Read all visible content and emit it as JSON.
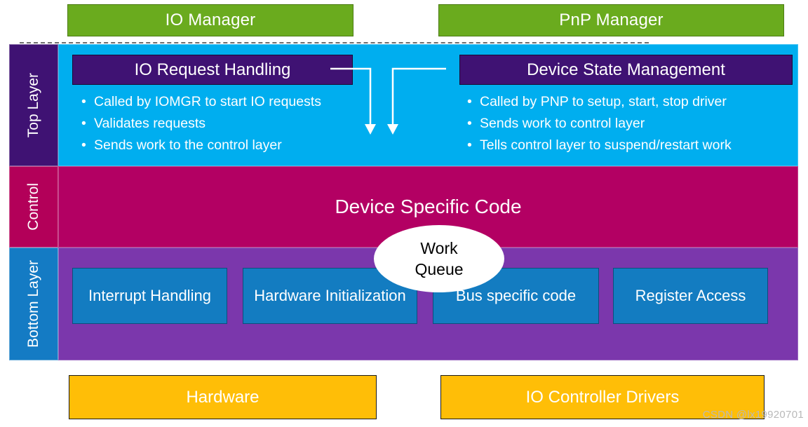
{
  "managers": [
    {
      "label": "IO Manager"
    },
    {
      "label": "PnP Manager"
    }
  ],
  "layers": {
    "top": {
      "tab_label": "Top Layer",
      "left_panel": {
        "header": "IO Request Handling",
        "bullets": [
          "Called by IOMGR to start IO requests",
          "Validates requests",
          "Sends work to the control layer"
        ]
      },
      "right_panel": {
        "header": "Device State Management",
        "bullets": [
          "Called by PNP to setup, start, stop driver",
          "Sends work to control layer",
          "Tells control layer to suspend/restart work"
        ]
      }
    },
    "control": {
      "tab_label": "Control",
      "caption": "Device Specific Code"
    },
    "bottom": {
      "tab_label": "Bottom Layer",
      "boxes": [
        {
          "label": "Interrupt Handling"
        },
        {
          "label": "Hardware Initialization"
        },
        {
          "label": "Bus specific code"
        },
        {
          "label": "Register Access"
        }
      ]
    }
  },
  "work_queue": {
    "line1": "Work",
    "line2": "Queue"
  },
  "hardware_row": [
    {
      "label": "Hardware"
    },
    {
      "label": "IO Controller Drivers"
    }
  ],
  "watermark": "CSDN @lx19920701",
  "colors": {
    "manager_green": "#6aab1e",
    "top_layer_blue": "#00aeef",
    "header_purple": "#3f1273",
    "control_magenta": "#b30063",
    "control_tab": "#b30059",
    "bottom_layer_purple": "#7b37ac",
    "bottom_box_blue": "#137cc1",
    "bottom_tab_blue": "#147bc4",
    "hardware_yellow": "#ffbe07",
    "arrow_white": "#ffffff",
    "watermark_gray": "#b9b9b9"
  },
  "icons": {
    "arrow_left": "elbow-arrow-down-icon",
    "arrow_right": "elbow-arrow-down-icon",
    "separator": "dashed-separator-icon"
  }
}
